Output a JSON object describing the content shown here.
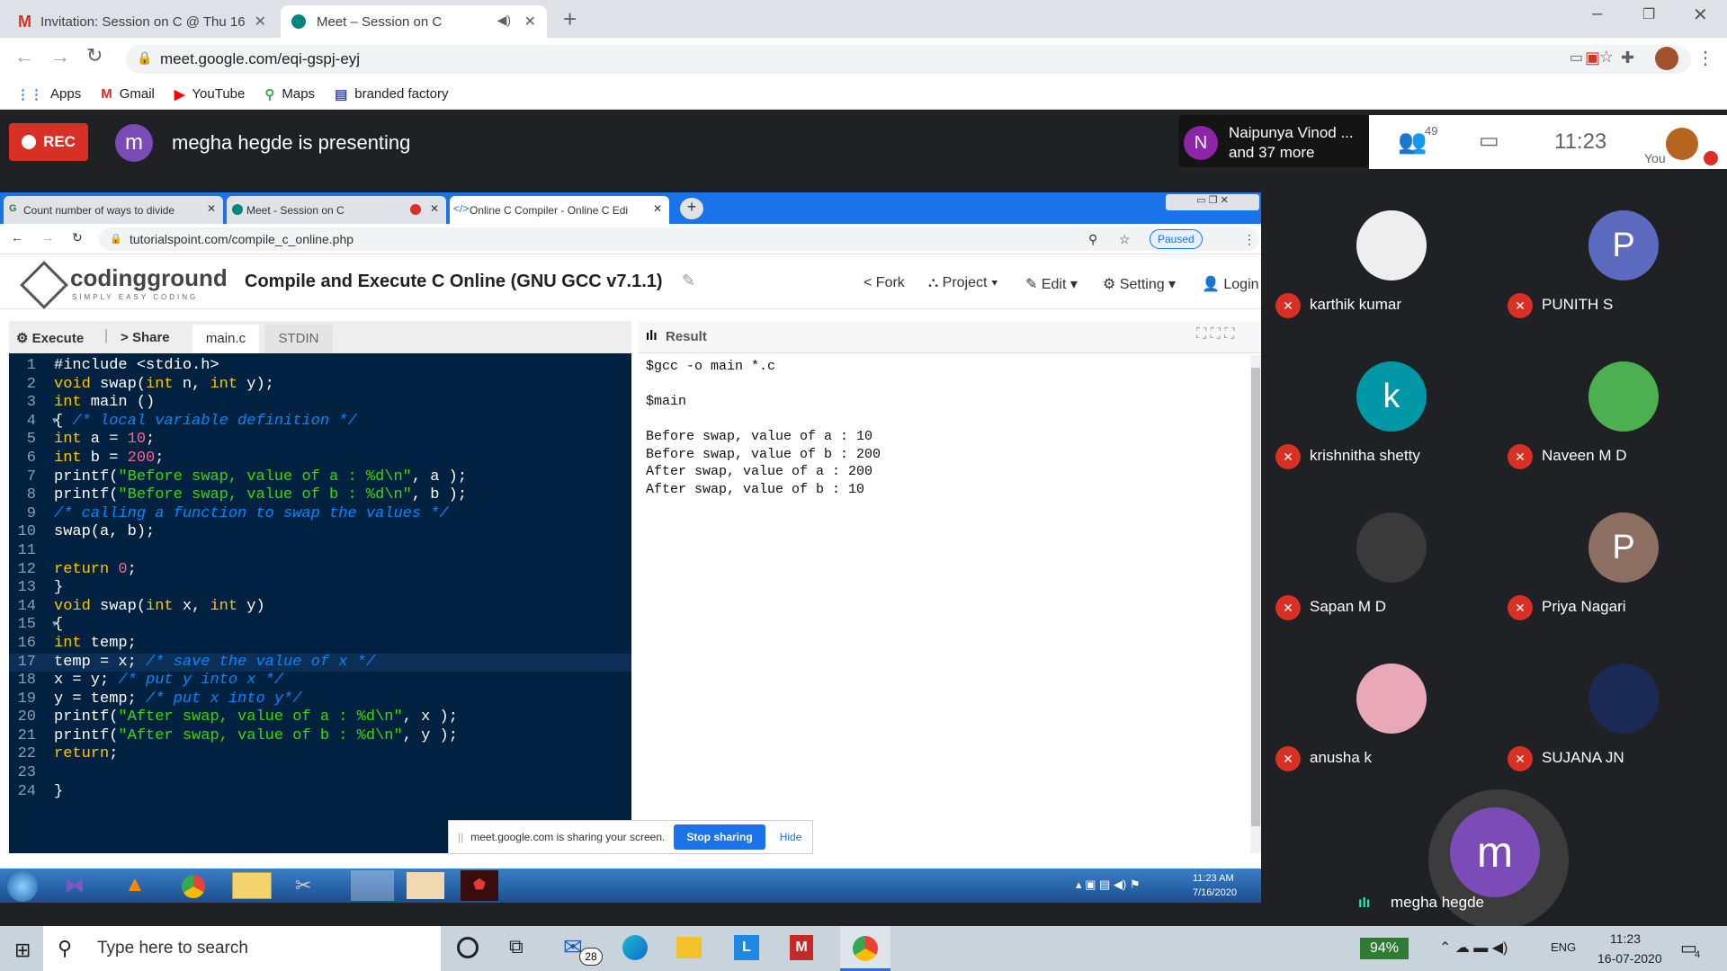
{
  "browser": {
    "tabs": [
      {
        "label": "Invitation: Session on C @ Thu 16",
        "icon": "gmail-icon"
      },
      {
        "label": "Meet – Session on C",
        "icon": "meet-icon"
      }
    ],
    "url": "meet.google.com/eqi-gspj-eyj",
    "bookmarks": [
      {
        "label": "Apps",
        "icon": "apps-grid-icon"
      },
      {
        "label": "Gmail",
        "icon": "gmail-icon"
      },
      {
        "label": "YouTube",
        "icon": "youtube-icon"
      },
      {
        "label": "Maps",
        "icon": "maps-pin-icon"
      },
      {
        "label": "branded factory",
        "icon": "bookmark-site-icon"
      }
    ]
  },
  "meet": {
    "rec_label": "REC",
    "presenter_initial": "m",
    "presenter_text": "megha hegde is presenting",
    "participants_summary": {
      "initial": "N",
      "line1": "Naipunya Vinod ...",
      "line2": "and 37 more"
    },
    "participant_count": "49",
    "clock": "11:23",
    "you_label": "You",
    "tiles": [
      {
        "name": "karthik kumar",
        "initial": "",
        "color": "#eeeeee"
      },
      {
        "name": "PUNITH S",
        "initial": "P",
        "color": "#5c6bc0"
      },
      {
        "name": "krishnitha shetty",
        "initial": "k",
        "color": "#0097a7"
      },
      {
        "name": "Naveen M D",
        "initial": "",
        "color": "#4caf50"
      },
      {
        "name": "Sapan M D",
        "initial": "",
        "color": "#3a3a3a"
      },
      {
        "name": "Priya Nagari",
        "initial": "P",
        "color": "#8d6e63"
      },
      {
        "name": "anusha k",
        "initial": "",
        "color": "#e8a8b8"
      },
      {
        "name": "SUJANA JN",
        "initial": "",
        "color": "#1a2a55"
      }
    ],
    "presenter_tile": {
      "initial": "m",
      "name": "megha hegde"
    }
  },
  "shared": {
    "tabs": [
      {
        "label": "Count number of ways to divide"
      },
      {
        "label": "Meet - Session on C"
      },
      {
        "label": "Online C Compiler - Online C Edi"
      }
    ],
    "url": "tutorialspoint.com/compile_c_online.php",
    "paused_label": "Paused",
    "logo_main": "codingground",
    "logo_sub": "SIMPLY EASY CODING",
    "page_title": "Compile and Execute C Online (GNU GCC v7.1.1)",
    "menu": [
      "Fork",
      "Project",
      "Edit",
      "Setting",
      "Login"
    ],
    "editor_buttons": [
      "Execute",
      "Share"
    ],
    "editor_tabs": [
      "main.c",
      "STDIN"
    ],
    "result_title": "Result",
    "result_text": "$gcc -o main *.c\n\n$main\n\nBefore swap, value of a : 10\nBefore swap, value of b : 200\nAfter swap, value of a : 200\nAfter swap, value of b : 10",
    "share_notice": "meet.google.com is sharing your screen.",
    "stop_label": "Stop sharing",
    "hide_label": "Hide",
    "win7_time": "11:23 AM",
    "win7_date": "7/16/2020"
  },
  "code_lines": [
    {
      "n": "1",
      "fold": "",
      "html": "<span class='pp'>#include &lt;stdio.h&gt;</span>"
    },
    {
      "n": "2",
      "fold": "",
      "html": "<span class='kw'>void</span> swap(<span class='kw'>int</span> n, <span class='kw'>int</span> y);"
    },
    {
      "n": "3",
      "fold": "",
      "html": "<span class='kw'>int</span> main ()"
    },
    {
      "n": "4",
      "fold": "▾",
      "html": "{ <span class='cmt'>/* local variable definition */</span>"
    },
    {
      "n": "5",
      "fold": "",
      "html": "<span class='kw'>int</span> a = <span class='numv'>10</span>;"
    },
    {
      "n": "6",
      "fold": "",
      "html": "<span class='kw'>int</span> b = <span class='numv'>200</span>;"
    },
    {
      "n": "7",
      "fold": "",
      "html": "printf(<span class='str'>\"Before swap, value of a : %d\\n\"</span>, a );"
    },
    {
      "n": "8",
      "fold": "",
      "html": "printf(<span class='str'>\"Before swap, value of b : %d\\n\"</span>, b );"
    },
    {
      "n": "9",
      "fold": "",
      "html": "<span class='cmt'>/* calling a function to swap the values */</span>"
    },
    {
      "n": "10",
      "fold": "",
      "html": "swap(a, b);"
    },
    {
      "n": "11",
      "fold": "",
      "html": ""
    },
    {
      "n": "12",
      "fold": "",
      "html": "<span class='kw'>return</span> <span class='numv'>0</span>;"
    },
    {
      "n": "13",
      "fold": "",
      "html": "}"
    },
    {
      "n": "14",
      "fold": "",
      "html": "<span class='kw'>void</span> swap(<span class='kw'>int</span> x, <span class='kw'>int</span> y)"
    },
    {
      "n": "15",
      "fold": "▾",
      "html": "{"
    },
    {
      "n": "16",
      "fold": "",
      "html": "<span class='kw'>int</span> temp;"
    },
    {
      "n": "17",
      "fold": "",
      "html": "temp = x; <span class='cmt'>/* save the value of x */</span>"
    },
    {
      "n": "18",
      "fold": "",
      "html": "x = y; <span class='cmt'>/* put y into x */</span>"
    },
    {
      "n": "19",
      "fold": "",
      "html": "y = temp; <span class='cmt'>/* put x into y*/</span>"
    },
    {
      "n": "20",
      "fold": "",
      "html": "printf(<span class='str'>\"After swap, value of a : %d\\n\"</span>, x );"
    },
    {
      "n": "21",
      "fold": "",
      "html": "printf(<span class='str'>\"After swap, value of b : %d\\n\"</span>, y );"
    },
    {
      "n": "22",
      "fold": "",
      "html": "<span class='kw'>return</span>;"
    },
    {
      "n": "23",
      "fold": "",
      "html": ""
    },
    {
      "n": "24",
      "fold": "",
      "html": "}"
    }
  ],
  "taskbar": {
    "search_placeholder": "Type here to search",
    "mail_badge": "28",
    "battery": "94%",
    "lang": "ENG",
    "time": "11:23",
    "date": "16-07-2020",
    "notif_count": "4"
  },
  "colors": {
    "rec": "#d93025",
    "accent": "#1a73e8",
    "meet_bg": "#202124"
  }
}
